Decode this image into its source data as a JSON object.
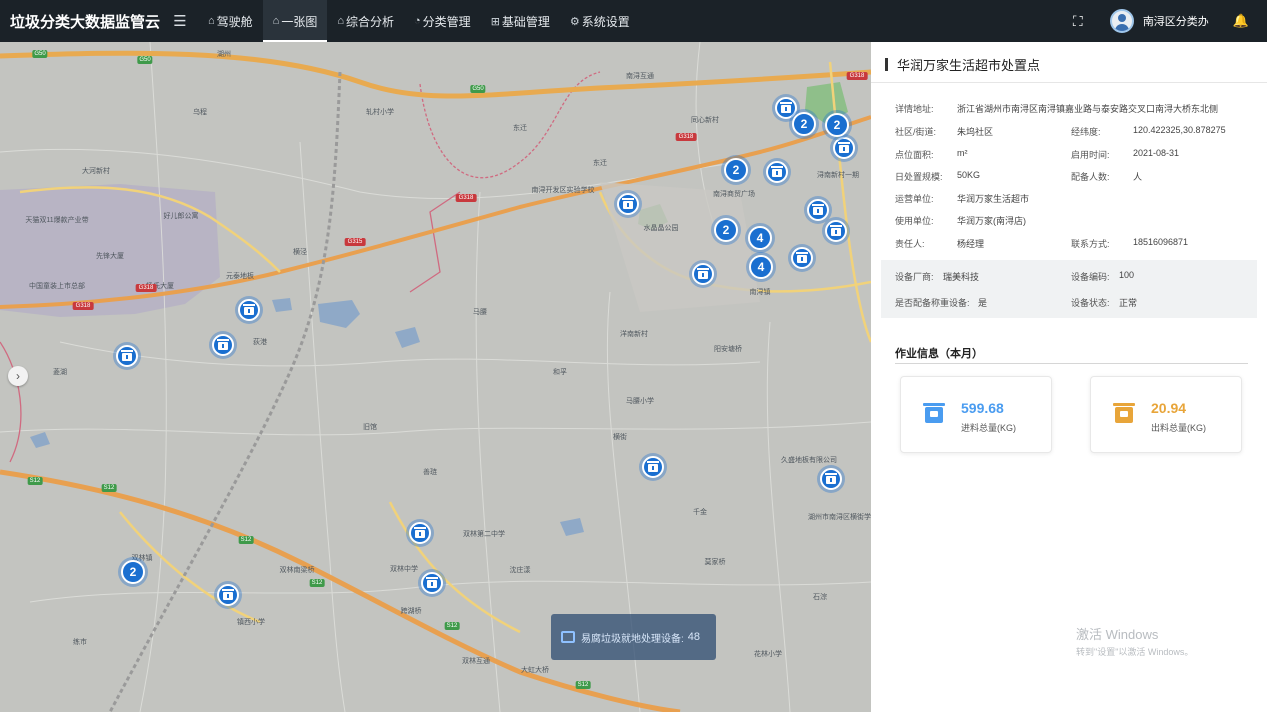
{
  "header": {
    "app_title": "垃圾分类大数据监管云",
    "menu_icon": "hamburger-icon",
    "nav": [
      {
        "label": "驾驶舱",
        "icon": "dashboard-icon",
        "active": false
      },
      {
        "label": "一张图",
        "icon": "map-icon",
        "active": true
      },
      {
        "label": "综合分析",
        "icon": "analysis-icon",
        "active": false
      },
      {
        "label": "分类管理",
        "icon": "classify-icon",
        "active": false
      },
      {
        "label": "基础管理",
        "icon": "grid-icon",
        "active": false
      },
      {
        "label": "系统设置",
        "icon": "settings-icon",
        "active": false
      }
    ],
    "user_name": "南浔区分类办",
    "colors": {
      "bar_bg": "#1b2228",
      "active_bg": "#2a333b"
    }
  },
  "map": {
    "place_labels": {
      "p1": "G50",
      "p2": "湖州",
      "p3": "菱湖",
      "p4": "双林镇",
      "p5": "南浔镇",
      "p6": "练市",
      "p7": "横泾",
      "p8": "荻港",
      "p9": "和孚",
      "p10": "善琏",
      "p11": "千金",
      "p12": "石淙",
      "p13": "旧馆",
      "p14": "马腰",
      "p15": "东迁",
      "p16": "横街",
      "p17": "沈庄漾",
      "p18": "莫家桥",
      "p19": "大河新村",
      "p20": "先锋大厦",
      "p21": "杨氏大厦",
      "p22": "中国童装上市总部",
      "p23": "天猫双11爆款产业带",
      "p24": "好儿郎公寓",
      "p25": "元泰地板",
      "p26": "水晶晶公园",
      "p27": "南浔商贸广场",
      "p28": "洋南新村",
      "p29": "阳安塘桥",
      "p30": "马腰小学",
      "p31": "久盛地板有限公司",
      "p32": "湖州市南浔区横街学校",
      "p33": "双林第二中学",
      "p34": "双林中学",
      "p35": "镇西小学",
      "p36": "双林南梁桥",
      "p37": "跨湖桥",
      "p38": "花林小学",
      "p39": "大虹大桥",
      "p40": "双林互通",
      "p41": "南浔互通",
      "p42": "G318",
      "p43": "S12",
      "p44": "G315",
      "p45": "乌程",
      "p46": "同心新村",
      "p47": "浔南新村一期",
      "p48": "东迁",
      "p49": "南浔开发区实验学校",
      "p50": "轧村小学"
    },
    "clusters": [
      {
        "count": "2"
      },
      {
        "count": "2"
      },
      {
        "count": "2"
      },
      {
        "count": "2"
      },
      {
        "count": "4"
      },
      {
        "count": "4"
      },
      {
        "count": "2"
      }
    ],
    "marker_icon": "trash-bin-icon",
    "tooltip": {
      "label": "易腐垃圾就地处理设备:",
      "value": "48"
    }
  },
  "panel": {
    "title": "华润万家生活超市处置点",
    "details": {
      "address_label": "详情地址:",
      "address": "浙江省湖州市南浔区南浔镇嘉业路与泰安路交叉口南浔大桥东北侧",
      "community_label": "社区/街道:",
      "community": "朱坞社区",
      "coords_label": "经纬度:",
      "coords": "120.422325,30.878275",
      "area_label": "点位面积:",
      "area": "m²",
      "start_label": "启用时间:",
      "start": "2021-08-31",
      "capacity_label": "日处置规模:",
      "capacity": "50KG",
      "staff_label": "配备人数:",
      "staff": "人",
      "operator_label": "运营单位:",
      "operator": "华润万家生活超市",
      "user_label": "使用单位:",
      "user": "华润万家(南浔店)",
      "owner_label": "责任人:",
      "owner": "杨经理",
      "contact_label": "联系方式:",
      "contact": "18516096871"
    },
    "equipment": {
      "vendor_label": "设备厂商:",
      "vendor": "瑞美科技",
      "code_label": "设备编码:",
      "code": "100",
      "scale_label": "是否配备称重设备:",
      "scale": "是",
      "status_label": "设备状态:",
      "status": "正常"
    },
    "work": {
      "title": "作业信息（本月）",
      "in_value": "599.68",
      "in_label": "进料总量(KG)",
      "in_color": "#4a9cf0",
      "out_value": "20.94",
      "out_label": "出料总量(KG)",
      "out_color": "#e8a53a"
    },
    "watermark": {
      "line1": "激活 Windows",
      "line2": "转到\"设置\"以激活 Windows。"
    }
  }
}
